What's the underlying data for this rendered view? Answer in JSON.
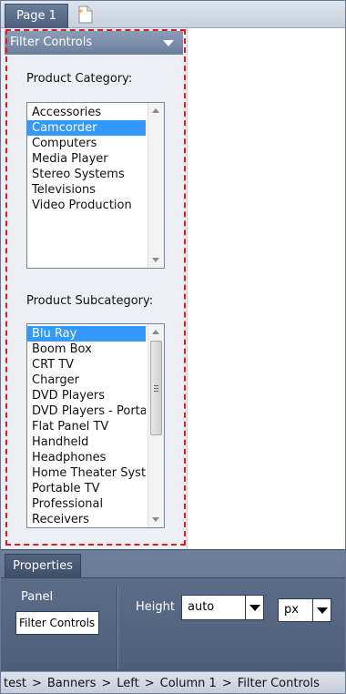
{
  "page_tabs": [
    {
      "label": "Page 1"
    }
  ],
  "panel": {
    "title": "Filter Controls",
    "category_label": "Product Category:",
    "categories": [
      "Accessories",
      "Camcorder",
      "Computers",
      "Media Player",
      "Stereo Systems",
      "Televisions",
      "Video Production"
    ],
    "selected_category": "Camcorder",
    "subcategory_label": "Product Subcategory:",
    "subcategories": [
      "Blu Ray",
      "Boom Box",
      "CRT TV",
      "Charger",
      "DVD Players",
      "DVD Players - Portable",
      "Flat Panel TV",
      "Handheld",
      "Headphones",
      "Home Theater System",
      "Portable TV",
      "Professional",
      "Receivers"
    ],
    "selected_subcategory": "Blu Ray"
  },
  "properties": {
    "tab_label": "Properties",
    "panel_label": "Panel",
    "panel_name_value": "Filter Controls",
    "height_label": "Height",
    "height_value": "auto",
    "unit_value": "px"
  },
  "breadcrumb": [
    "test",
    "Banners",
    "Left",
    "Column 1",
    "Filter Controls"
  ],
  "icons": {
    "new_page": "new-page-icon",
    "collapse": "chevron-down-icon"
  },
  "colors": {
    "selection_outline": "#e01b1b",
    "list_selected": "#3399ff",
    "header_bg": "#7a8dab"
  }
}
